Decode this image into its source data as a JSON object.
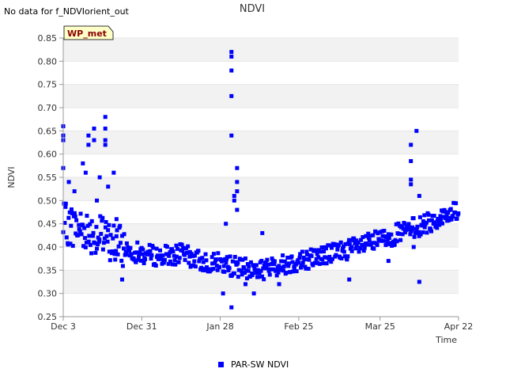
{
  "notice": "No data for f_NDVIorient_out",
  "badge": "WP_met",
  "colors": {
    "series": "#0000ff",
    "band": "#f2f2f2",
    "axis": "#999999",
    "badge_bg": "#ffffc8",
    "badge_text": "#8b0000"
  },
  "chart_data": {
    "type": "scatter",
    "title": "NDVI",
    "xlabel": "Time",
    "ylabel": "NDVI",
    "xlim": [
      "2023-12-03",
      "2024-04-22"
    ],
    "ylim": [
      0.25,
      0.85
    ],
    "grid": "alternating horizontal bands",
    "legend_position": "bottom-center",
    "x_ticks": [
      {
        "date": "2023-12-03",
        "label": "Dec 3"
      },
      {
        "date": "2023-12-31",
        "label": "Dec 31"
      },
      {
        "date": "2024-01-28",
        "label": "Jan 28"
      },
      {
        "date": "2024-02-25",
        "label": "Feb 25"
      },
      {
        "date": "2024-03-25",
        "label": "Mar 25"
      },
      {
        "date": "2024-04-22",
        "label": "Apr 22"
      }
    ],
    "y_ticks": [
      0.25,
      0.3,
      0.35,
      0.4,
      0.45,
      0.5,
      0.55,
      0.6,
      0.65,
      0.7,
      0.75,
      0.8,
      0.85
    ],
    "series": [
      {
        "name": "PAR-SW NDVI",
        "marker": "square",
        "trend": [
          [
            "2023-12-03",
            0.45
          ],
          [
            "2023-12-10",
            0.44
          ],
          [
            "2023-12-17",
            0.42
          ],
          [
            "2023-12-24",
            0.4
          ],
          [
            "2023-12-31",
            0.385
          ],
          [
            "2024-01-07",
            0.38
          ],
          [
            "2024-01-14",
            0.385
          ],
          [
            "2024-01-21",
            0.37
          ],
          [
            "2024-01-28",
            0.365
          ],
          [
            "2024-02-04",
            0.355
          ],
          [
            "2024-02-11",
            0.35
          ],
          [
            "2024-02-18",
            0.36
          ],
          [
            "2024-02-25",
            0.37
          ],
          [
            "2024-03-03",
            0.38
          ],
          [
            "2024-03-10",
            0.39
          ],
          [
            "2024-03-17",
            0.4
          ],
          [
            "2024-03-25",
            0.415
          ],
          [
            "2024-04-01",
            0.43
          ],
          [
            "2024-04-08",
            0.445
          ],
          [
            "2024-04-15",
            0.46
          ],
          [
            "2024-04-22",
            0.48
          ]
        ],
        "outliers": [
          [
            "2023-12-03",
            0.66
          ],
          [
            "2023-12-03",
            0.64
          ],
          [
            "2023-12-03",
            0.63
          ],
          [
            "2023-12-03",
            0.57
          ],
          [
            "2023-12-05",
            0.54
          ],
          [
            "2023-12-07",
            0.52
          ],
          [
            "2023-12-10",
            0.58
          ],
          [
            "2023-12-11",
            0.56
          ],
          [
            "2023-12-12",
            0.62
          ],
          [
            "2023-12-12",
            0.64
          ],
          [
            "2023-12-14",
            0.655
          ],
          [
            "2023-12-14",
            0.63
          ],
          [
            "2023-12-15",
            0.5
          ],
          [
            "2023-12-16",
            0.55
          ],
          [
            "2023-12-18",
            0.68
          ],
          [
            "2023-12-18",
            0.655
          ],
          [
            "2023-12-18",
            0.63
          ],
          [
            "2023-12-18",
            0.62
          ],
          [
            "2023-12-19",
            0.53
          ],
          [
            "2023-12-21",
            0.56
          ],
          [
            "2023-12-22",
            0.46
          ],
          [
            "2023-12-24",
            0.33
          ],
          [
            "2024-02-01",
            0.82
          ],
          [
            "2024-02-01",
            0.81
          ],
          [
            "2024-02-01",
            0.78
          ],
          [
            "2024-02-01",
            0.725
          ],
          [
            "2024-02-01",
            0.64
          ],
          [
            "2024-02-01",
            0.27
          ],
          [
            "2024-02-02",
            0.51
          ],
          [
            "2024-02-02",
            0.5
          ],
          [
            "2024-02-03",
            0.57
          ],
          [
            "2024-02-03",
            0.54
          ],
          [
            "2024-02-03",
            0.52
          ],
          [
            "2024-02-03",
            0.48
          ],
          [
            "2024-01-30",
            0.45
          ],
          [
            "2024-01-29",
            0.3
          ],
          [
            "2024-02-06",
            0.32
          ],
          [
            "2024-02-09",
            0.3
          ],
          [
            "2024-02-12",
            0.43
          ],
          [
            "2024-02-18",
            0.32
          ],
          [
            "2024-03-14",
            0.33
          ],
          [
            "2024-04-05",
            0.62
          ],
          [
            "2024-04-05",
            0.585
          ],
          [
            "2024-04-05",
            0.545
          ],
          [
            "2024-04-05",
            0.535
          ],
          [
            "2024-04-07",
            0.65
          ],
          [
            "2024-04-08",
            0.51
          ],
          [
            "2024-04-08",
            0.325
          ],
          [
            "2024-04-06",
            0.4
          ],
          [
            "2024-03-28",
            0.37
          ]
        ]
      }
    ]
  }
}
